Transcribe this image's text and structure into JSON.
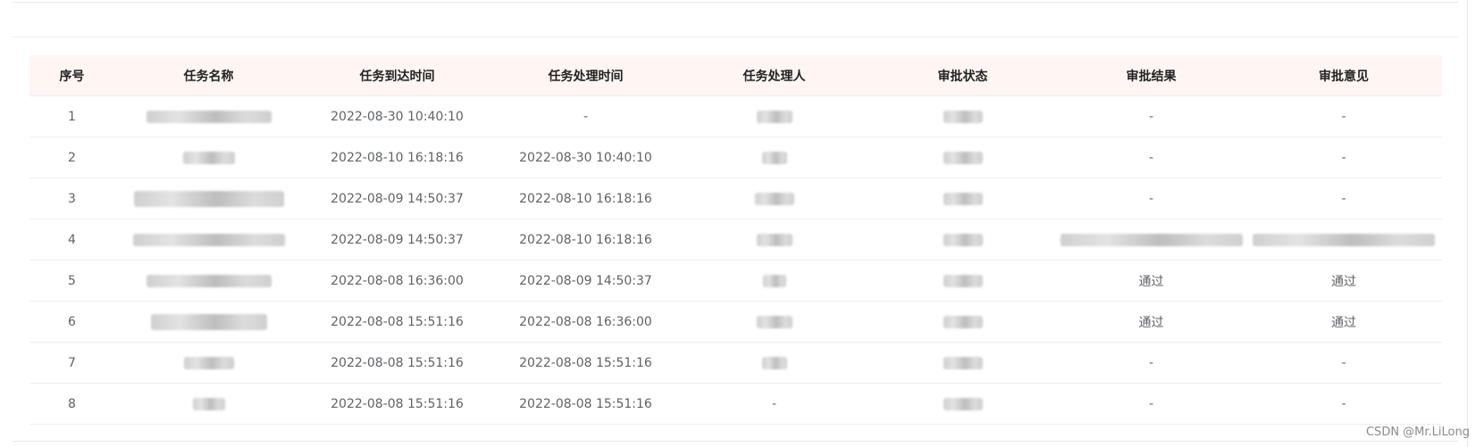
{
  "table": {
    "headers": [
      "序号",
      "任务名称",
      "任务到达时间",
      "任务处理时间",
      "任务处理人",
      "审批状态",
      "审批结果",
      "审批意见"
    ],
    "rows": [
      {
        "no": "1",
        "arrive": "2022-08-30 10:40:10",
        "handle": "-",
        "result": "-",
        "opinion": "-"
      },
      {
        "no": "2",
        "arrive": "2022-08-10 16:18:16",
        "handle": "2022-08-30 10:40:10",
        "result": "-",
        "opinion": "-"
      },
      {
        "no": "3",
        "arrive": "2022-08-09 14:50:37",
        "handle": "2022-08-10 16:18:16",
        "result": "-",
        "opinion": "-"
      },
      {
        "no": "4",
        "arrive": "2022-08-09 14:50:37",
        "handle": "2022-08-10 16:18:16",
        "result": "",
        "opinion": ""
      },
      {
        "no": "5",
        "arrive": "2022-08-08 16:36:00",
        "handle": "2022-08-09 14:50:37",
        "result": "通过",
        "opinion": "通过"
      },
      {
        "no": "6",
        "arrive": "2022-08-08 15:51:16",
        "handle": "2022-08-08 16:36:00",
        "result": "通过",
        "opinion": "通过"
      },
      {
        "no": "7",
        "arrive": "2022-08-08 15:51:16",
        "handle": "2022-08-08 15:51:16",
        "result": "-",
        "opinion": "-"
      },
      {
        "no": "8",
        "arrive": "2022-08-08 15:51:16",
        "handle": "2022-08-08 15:51:16",
        "result": "-",
        "opinion": "-"
      }
    ],
    "row8_handler": "-"
  },
  "watermark": "CSDN @Mr.LiLong"
}
